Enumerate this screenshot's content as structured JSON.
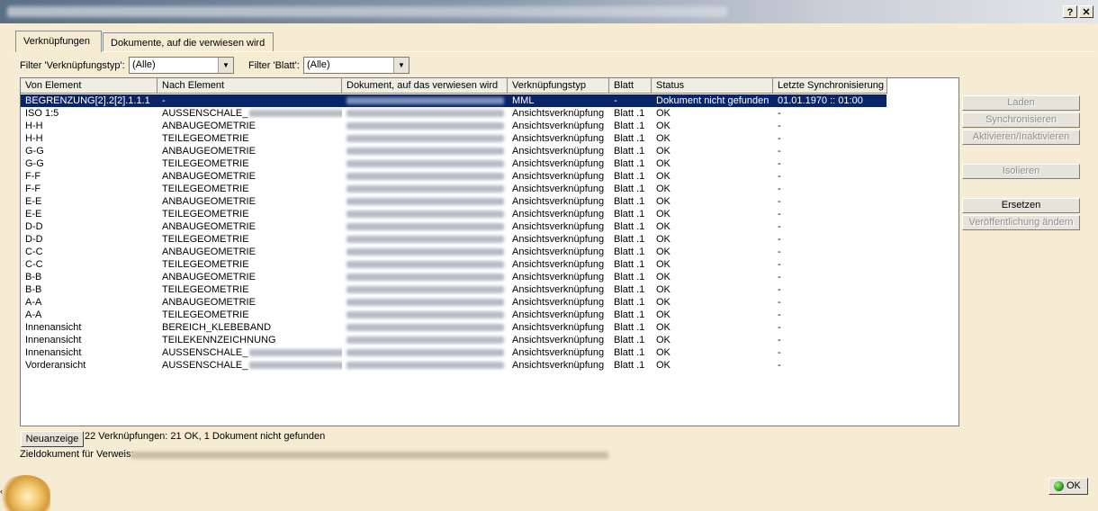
{
  "window": {
    "help_label": "?",
    "close_label": "✕"
  },
  "tabs": [
    {
      "label": "Verknüpfungen",
      "active": true
    },
    {
      "label": "Dokumente, auf die verwiesen wird",
      "active": false
    }
  ],
  "filters": {
    "type_label": "Filter 'Verknüpfungstyp':",
    "type_value": "(Alle)",
    "sheet_label": "Filter 'Blatt':",
    "sheet_value": "(Alle)",
    "dropdown_icon": "triangle-down"
  },
  "table": {
    "columns": [
      "Von Element",
      "Nach Element",
      "Dokument, auf das verwiesen wird",
      "Verknüpfungstyp",
      "Blatt",
      "Status",
      "Letzte Synchronisierung"
    ],
    "rows": [
      {
        "from": "BEGRENZUNG[2].2[2].1.1.1",
        "to": "-",
        "to_suffix_blurred": false,
        "type": "MML",
        "sheet": "-",
        "status": "Dokument nicht gefunden",
        "sync": "01.01.1970 :: 01:00",
        "selected": true
      },
      {
        "from": "ISO 1:5",
        "to": "AUSSENSCHALE_",
        "to_suffix_blurred": true,
        "type": "Ansichtsverknüpfung",
        "sheet": "Blatt .1",
        "status": "OK",
        "sync": "-",
        "selected": false
      },
      {
        "from": "H-H",
        "to": "ANBAUGEOMETRIE",
        "to_suffix_blurred": false,
        "type": "Ansichtsverknüpfung",
        "sheet": "Blatt .1",
        "status": "OK",
        "sync": "-",
        "selected": false
      },
      {
        "from": "H-H",
        "to": "TEILEGEOMETRIE",
        "to_suffix_blurred": false,
        "type": "Ansichtsverknüpfung",
        "sheet": "Blatt .1",
        "status": "OK",
        "sync": "-",
        "selected": false
      },
      {
        "from": "G-G",
        "to": "ANBAUGEOMETRIE",
        "to_suffix_blurred": false,
        "type": "Ansichtsverknüpfung",
        "sheet": "Blatt .1",
        "status": "OK",
        "sync": "-",
        "selected": false
      },
      {
        "from": "G-G",
        "to": "TEILEGEOMETRIE",
        "to_suffix_blurred": false,
        "type": "Ansichtsverknüpfung",
        "sheet": "Blatt .1",
        "status": "OK",
        "sync": "-",
        "selected": false
      },
      {
        "from": "F-F",
        "to": "ANBAUGEOMETRIE",
        "to_suffix_blurred": false,
        "type": "Ansichtsverknüpfung",
        "sheet": "Blatt .1",
        "status": "OK",
        "sync": "-",
        "selected": false
      },
      {
        "from": "F-F",
        "to": "TEILEGEOMETRIE",
        "to_suffix_blurred": false,
        "type": "Ansichtsverknüpfung",
        "sheet": "Blatt .1",
        "status": "OK",
        "sync": "-",
        "selected": false
      },
      {
        "from": "E-E",
        "to": "ANBAUGEOMETRIE",
        "to_suffix_blurred": false,
        "type": "Ansichtsverknüpfung",
        "sheet": "Blatt .1",
        "status": "OK",
        "sync": "-",
        "selected": false
      },
      {
        "from": "E-E",
        "to": "TEILEGEOMETRIE",
        "to_suffix_blurred": false,
        "type": "Ansichtsverknüpfung",
        "sheet": "Blatt .1",
        "status": "OK",
        "sync": "-",
        "selected": false
      },
      {
        "from": "D-D",
        "to": "ANBAUGEOMETRIE",
        "to_suffix_blurred": false,
        "type": "Ansichtsverknüpfung",
        "sheet": "Blatt .1",
        "status": "OK",
        "sync": "-",
        "selected": false
      },
      {
        "from": "D-D",
        "to": "TEILEGEOMETRIE",
        "to_suffix_blurred": false,
        "type": "Ansichtsverknüpfung",
        "sheet": "Blatt .1",
        "status": "OK",
        "sync": "-",
        "selected": false
      },
      {
        "from": "C-C",
        "to": "ANBAUGEOMETRIE",
        "to_suffix_blurred": false,
        "type": "Ansichtsverknüpfung",
        "sheet": "Blatt .1",
        "status": "OK",
        "sync": "-",
        "selected": false
      },
      {
        "from": "C-C",
        "to": "TEILEGEOMETRIE",
        "to_suffix_blurred": false,
        "type": "Ansichtsverknüpfung",
        "sheet": "Blatt .1",
        "status": "OK",
        "sync": "-",
        "selected": false
      },
      {
        "from": "B-B",
        "to": "ANBAUGEOMETRIE",
        "to_suffix_blurred": false,
        "type": "Ansichtsverknüpfung",
        "sheet": "Blatt .1",
        "status": "OK",
        "sync": "-",
        "selected": false
      },
      {
        "from": "B-B",
        "to": "TEILEGEOMETRIE",
        "to_suffix_blurred": false,
        "type": "Ansichtsverknüpfung",
        "sheet": "Blatt .1",
        "status": "OK",
        "sync": "-",
        "selected": false
      },
      {
        "from": "A-A",
        "to": "ANBAUGEOMETRIE",
        "to_suffix_blurred": false,
        "type": "Ansichtsverknüpfung",
        "sheet": "Blatt .1",
        "status": "OK",
        "sync": "-",
        "selected": false
      },
      {
        "from": "A-A",
        "to": "TEILEGEOMETRIE",
        "to_suffix_blurred": false,
        "type": "Ansichtsverknüpfung",
        "sheet": "Blatt .1",
        "status": "OK",
        "sync": "-",
        "selected": false
      },
      {
        "from": "Innenansicht",
        "to": "BEREICH_KLEBEBAND",
        "to_suffix_blurred": false,
        "type": "Ansichtsverknüpfung",
        "sheet": "Blatt .1",
        "status": "OK",
        "sync": "-",
        "selected": false
      },
      {
        "from": "Innenansicht",
        "to": "TEILEKENNZEICHNUNG",
        "to_suffix_blurred": false,
        "type": "Ansichtsverknüpfung",
        "sheet": "Blatt .1",
        "status": "OK",
        "sync": "-",
        "selected": false
      },
      {
        "from": "Innenansicht",
        "to": "AUSSENSCHALE_",
        "to_suffix_blurred": true,
        "type": "Ansichtsverknüpfung",
        "sheet": "Blatt .1",
        "status": "OK",
        "sync": "-",
        "selected": false
      },
      {
        "from": "Vorderansicht",
        "to": "AUSSENSCHALE_",
        "to_suffix_blurred": true,
        "type": "Ansichtsverknüpfung",
        "sheet": "Blatt .1",
        "status": "OK",
        "sync": "-",
        "selected": false
      }
    ]
  },
  "side_buttons": [
    {
      "label": "Laden",
      "enabled": false
    },
    {
      "label": "Synchronisieren",
      "enabled": false
    },
    {
      "label": "Aktivieren/Inaktivieren",
      "enabled": false
    },
    {
      "label": "Isolieren",
      "enabled": false
    },
    {
      "label": "Ersetzen",
      "enabled": true
    },
    {
      "label": "Veröffentlichung ändern",
      "enabled": false
    }
  ],
  "footer": {
    "refresh_label": "Neuanzeige",
    "summary": "22 Verknüpfungen: 21 OK, 1 Dokument nicht gefunden",
    "target_label": "Zieldokument für Verweis:",
    "ok_label": "OK"
  },
  "colors": {
    "dialog_bg": "#f5ecd3",
    "selection": "#0a246a",
    "ok_icon": "#2fa81f"
  }
}
